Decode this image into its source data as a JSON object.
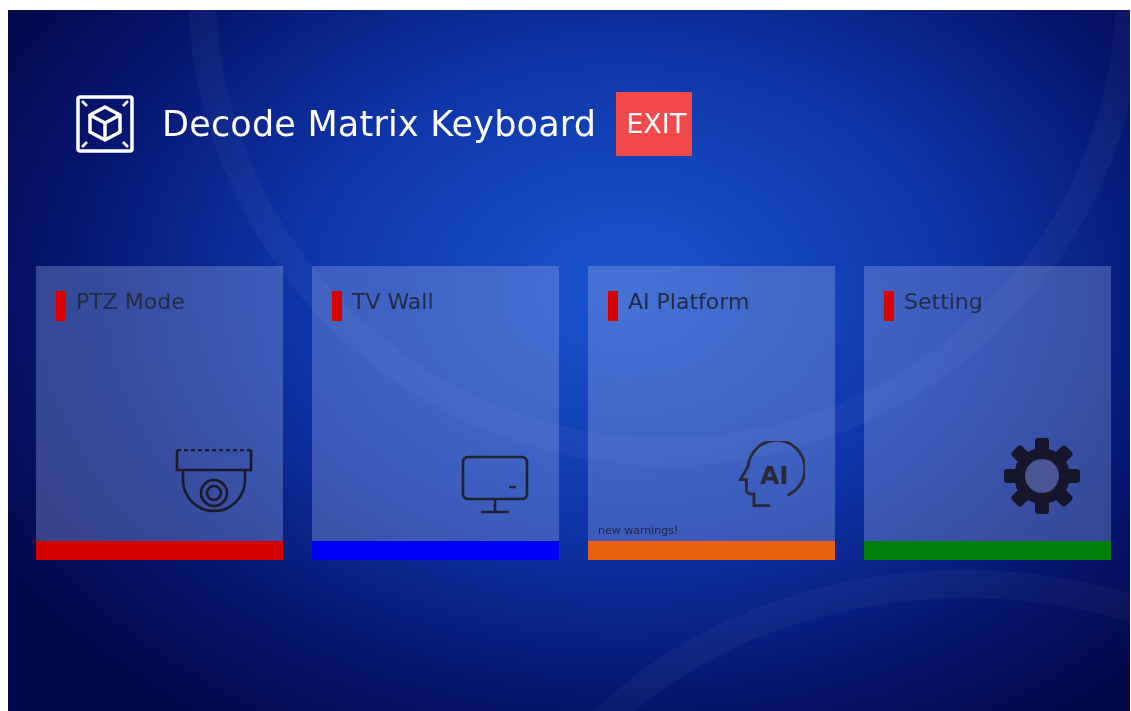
{
  "header": {
    "title": "Decode Matrix Keyboard",
    "exit_button": "EXIT"
  },
  "tiles": [
    {
      "label": "PTZ Mode",
      "kind": "camera",
      "color": "#d40000"
    },
    {
      "label": "TV Wall",
      "kind": "monitor",
      "color": "#0000f5"
    },
    {
      "label": "AI Platform",
      "kind": "ai",
      "icon_text": "AI",
      "note": "new warnings!",
      "color": "#ea600f"
    },
    {
      "label": "Setting",
      "kind": "gear",
      "color": "#00800a"
    }
  ]
}
